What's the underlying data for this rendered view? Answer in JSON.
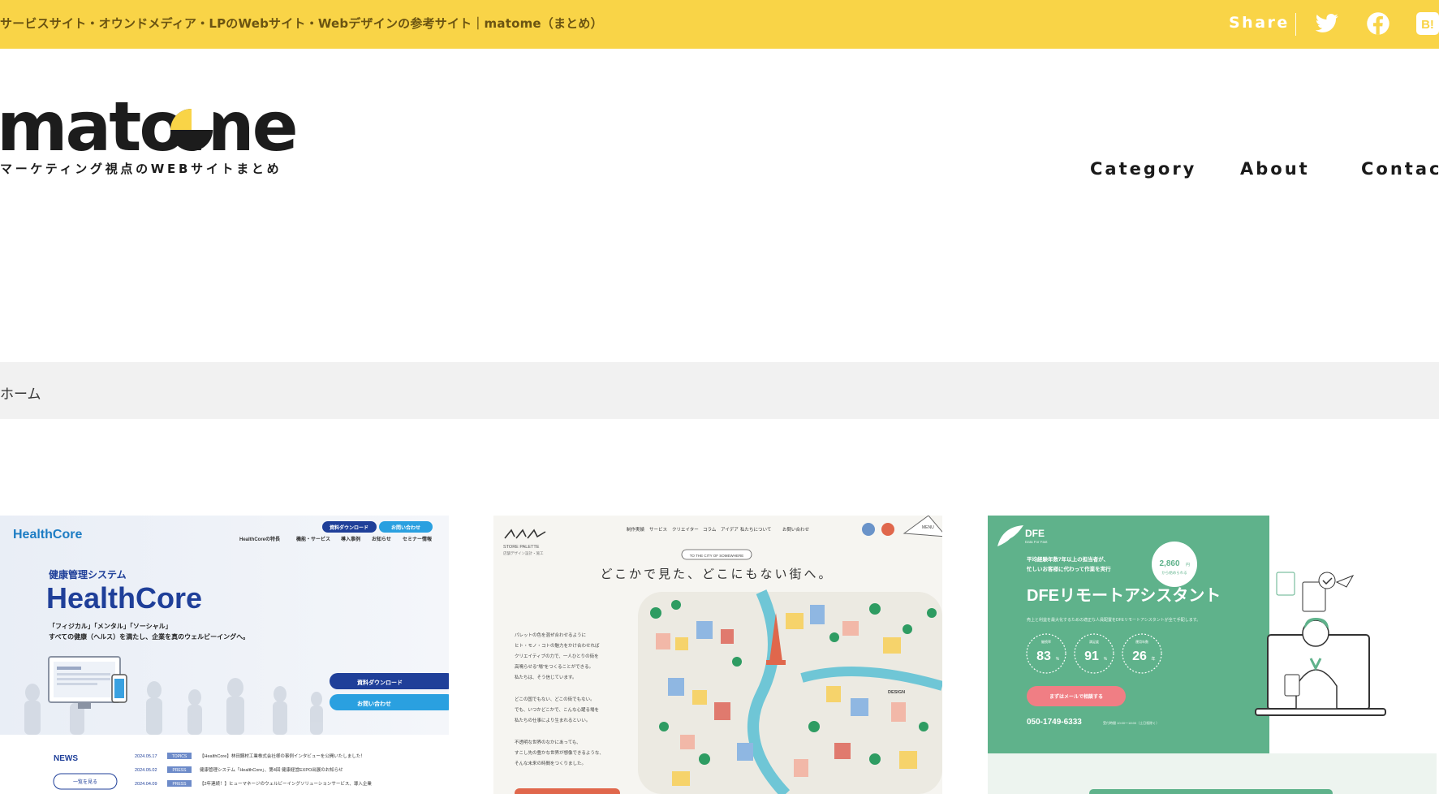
{
  "topbar": {
    "title": "サービスサイト・オウンドメディア・LPのWebサイト・Webデザインの参考サイト｜matome（まとめ）",
    "share_label": "Share",
    "icons": [
      "twitter-icon",
      "facebook-icon",
      "hatena-bookmark-icon"
    ],
    "hatena_label": "B!",
    "bg_color": "#f9d447"
  },
  "logo": {
    "wordmark": "matome",
    "tagline": "マーケティング視点のWEBサイトまとめ"
  },
  "nav": {
    "items": [
      "Category",
      "About",
      "Contact"
    ]
  },
  "breadcrumb": {
    "home": "ホーム"
  },
  "cards": [
    {
      "brand": "HealthCore",
      "btn_download": "資料ダウンロード",
      "btn_contact": "お問い合わせ",
      "menu": [
        "HealthCoreの特長",
        "機能・サービス",
        "導入事例",
        "お知らせ",
        "セミナー情報"
      ],
      "category_label": "健康管理システム",
      "hero_title": "HealthCore",
      "tagline": "「フィジカル」「メンタル」「ソーシャル」",
      "tagline2": "すべての健康（ヘルス）を満たし、企業を真のウェルビーイングへ。",
      "news_label": "NEWS",
      "news_more": "一覧を見る",
      "news": [
        {
          "date": "2024.05.17",
          "tag": "TOPICS",
          "text": "【HealthCore】林田鋼材工業株式会社様の事例インタビューを公開いたしました！"
        },
        {
          "date": "2024.05.02",
          "tag": "PRESS",
          "text": "健康管理システム「HealthCore」、第4回 健康経営EXPO出展のお知らせ"
        },
        {
          "date": "2024.04.09",
          "tag": "PRESS",
          "text": "【2年連続！】ヒューマネージのウェルビーイングソリューションサービス、導入企業"
        }
      ]
    },
    {
      "brand": "STORE PALETTE",
      "brand_sub": "店舗デザイン設計・施工",
      "menu": [
        "制作実績",
        "サービス",
        "クリエイター",
        "コラム",
        "アイデア",
        "私たちについて",
        "お問い合わせ"
      ],
      "menu_label": "MENU",
      "pill": "TO THE CITY OF SOMEWHERE",
      "headline": "どこかで見た、どこにもない街へ。",
      "body": [
        "パレットの色を混ぜ合わせるように",
        "ヒト・モノ・コトの魅力をかけ合わせれば",
        "クリエイティブの力で、一人ひとりの街を",
        "高鳴らせる\"場\"をつくることができる。",
        "私たちは、そう信じています。",
        "",
        "どこの国でもない、どこの街でもない。",
        "でも、いつかどこかで、こんな心躍る場を",
        "私たちの仕事により生まれるといい。",
        "",
        "不透明な世界のなかにあっても、",
        "すこし先の豊かな世界が想像できるような、",
        "そんな未来の時間をつくりました。"
      ],
      "design_label": "DESIGN"
    },
    {
      "brand": "DFE",
      "brand_sub": "Data For Fast",
      "lead1": "平均経験年数7年以上の担当者が、",
      "lead2": "忙しいお客様に代わって作業を実行",
      "price": "2,860",
      "price_unit": "円",
      "price_sub": "から始められる",
      "title": "DFEリモートアシスタント",
      "desc": "売上と利益を最大化するための適正な人員配置をDFEリモートアシスタントが全て手配します。",
      "stats": [
        {
          "label": "継続率",
          "value": "83",
          "unit": "%"
        },
        {
          "label": "満足度",
          "value": "91",
          "unit": "%"
        },
        {
          "label": "運用年数",
          "value": "26",
          "unit": "年"
        }
      ],
      "cta": "まずはメールで相談する",
      "phone": "050-1749-6333",
      "hours": "受付時間 10:00〜18:00（土日祝除く）"
    }
  ]
}
